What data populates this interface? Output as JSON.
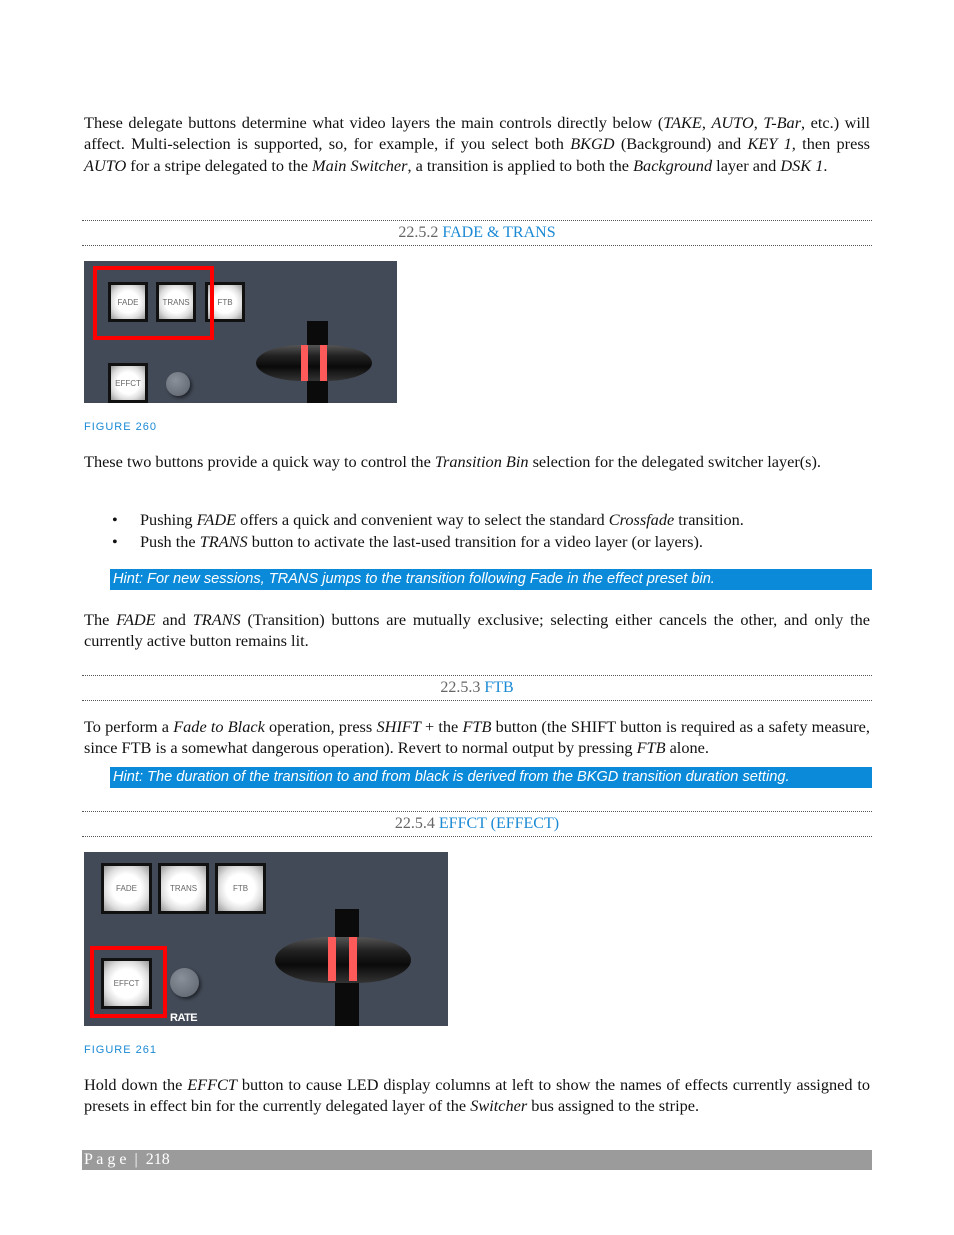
{
  "intro": [
    {
      "t": "These delegate buttons determine what video layers the main controls directly below ("
    },
    {
      "t": "TAKE",
      "i": 1
    },
    {
      "t": ", "
    },
    {
      "t": "AUTO",
      "i": 1
    },
    {
      "t": ", "
    },
    {
      "t": "T-Bar",
      "i": 1
    },
    {
      "t": ", etc.) will affect.  Multi-selection is supported, so, for example, if you select both "
    },
    {
      "t": "BKGD",
      "i": 1
    },
    {
      "t": " (Background) and "
    },
    {
      "t": "KEY 1,",
      "i": 1
    },
    {
      "t": " then press "
    },
    {
      "t": "AUTO",
      "i": 1
    },
    {
      "t": " for a stripe delegated to the "
    },
    {
      "t": "Main Switcher",
      "i": 1
    },
    {
      "t": ", a transition is applied to both the "
    },
    {
      "t": "Background",
      "i": 1
    },
    {
      "t": " layer and "
    },
    {
      "t": "DSK 1",
      "i": 1
    },
    {
      "t": "."
    }
  ],
  "section_fade": {
    "number": "22.5.2",
    "title": "FADE & TRANS"
  },
  "figure260": {
    "caption": "FIGURE 260",
    "buttons": [
      "FADE",
      "TRANS",
      "FTB",
      "EFFCT"
    ]
  },
  "fade_para": [
    {
      "t": "These two buttons provide a quick way to control the "
    },
    {
      "t": "Transition Bin",
      "i": 1
    },
    {
      "t": " selection for the delegated switcher layer(s)."
    }
  ],
  "bullets": [
    [
      {
        "t": "Pushing "
      },
      {
        "t": "FADE",
        "i": 1
      },
      {
        "t": " offers a quick and convenient way to select the standard "
      },
      {
        "t": "Crossfade",
        "i": 1
      },
      {
        "t": " transition."
      }
    ],
    [
      {
        "t": "Push the "
      },
      {
        "t": "TRANS",
        "i": 1
      },
      {
        "t": " button to activate the last-used transition for a video layer (or layers)."
      }
    ]
  ],
  "hint1": "Hint: For new sessions, TRANS jumps to the transition following Fade in the effect preset bin.",
  "exclusive_para": [
    {
      "t": "The "
    },
    {
      "t": "FADE",
      "i": 1
    },
    {
      "t": " and "
    },
    {
      "t": "TRANS",
      "i": 1
    },
    {
      "t": " (Transition) buttons are mutually exclusive; selecting either cancels the other, and only the currently active button remains lit."
    }
  ],
  "section_ftb": {
    "number": "22.5.3",
    "title": "FTB"
  },
  "ftb_para": [
    {
      "t": "To perform a "
    },
    {
      "t": "Fade to Black",
      "i": 1
    },
    {
      "t": " operation, press "
    },
    {
      "t": "SHIFT",
      "i": 1
    },
    {
      "t": " + the "
    },
    {
      "t": "FTB",
      "i": 1
    },
    {
      "t": " button (the SHIFT button is required as a safety measure, since FTB is a somewhat dangerous operation). Revert to normal output by pressing "
    },
    {
      "t": "FTB",
      "i": 1
    },
    {
      "t": " alone."
    }
  ],
  "hint2": "Hint: The duration of the transition to and from black is derived from the BKGD transition duration setting.",
  "section_effct": {
    "number": "22.5.4",
    "title": "EFFCT (EFFECT)"
  },
  "figure261": {
    "caption": "FIGURE 261",
    "buttons": [
      "FADE",
      "TRANS",
      "FTB",
      "EFFCT"
    ],
    "rate_label": "RATE"
  },
  "effct_para": [
    {
      "t": "Hold down the "
    },
    {
      "t": "EFFCT",
      "i": 1
    },
    {
      "t": " button to cause LED display columns at left to show the names of effects currently assigned to presets in effect bin for the currently delegated layer of the "
    },
    {
      "t": "Switcher",
      "i": 1
    },
    {
      "t": " bus assigned to the stripe."
    }
  ],
  "footer": {
    "page_label": "P a g e  |  218"
  },
  "colors": {
    "accent": "#1a8ad4",
    "hint_bg": "#0a8ad8",
    "highlight": "#ff0000",
    "footer_bg": "#9b9b9b"
  }
}
